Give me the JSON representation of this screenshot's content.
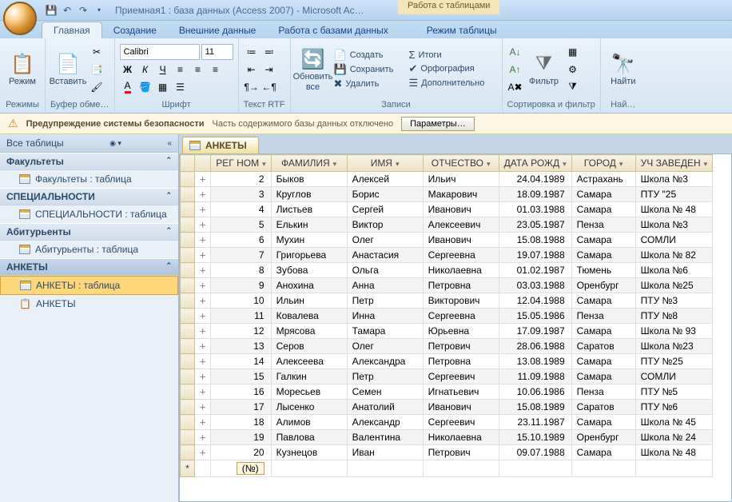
{
  "title": "Приемная1 : база данных (Access 2007) - Microsoft Ac…",
  "context_caption": "Работа с таблицами",
  "tabs": [
    "Главная",
    "Создание",
    "Внешние данные",
    "Работа с базами данных",
    "Режим таблицы"
  ],
  "ribbon": {
    "groups": [
      "Режимы",
      "Буфер обме…",
      "Шрифт",
      "Текст RTF",
      "Записи",
      "Сортировка и фильтр",
      "Най…"
    ],
    "rezhim": "Режим",
    "vstavit": "Вставить",
    "font_name": "Calibri",
    "font_size": "11",
    "obnovit": "Обновить все",
    "records": {
      "sozdat": "Создать",
      "sokhranit": "Сохранить",
      "udalit": "Удалить",
      "itogi": "Итоги",
      "orfo": "Орфография",
      "dopolnit": "Дополнительно"
    },
    "filtr": "Фильтр",
    "najti": "Найти"
  },
  "security": {
    "title": "Предупреждение системы безопасности",
    "text": "Часть содержимого базы данных отключено",
    "button": "Параметры…"
  },
  "nav": {
    "head": "Все таблицы",
    "groups": [
      {
        "name": "Факультеты",
        "items": [
          "Факультеты : таблица"
        ]
      },
      {
        "name": "СПЕЦИАЛЬНОСТИ",
        "items": [
          "СПЕЦИАЛЬНОСТИ : таблица"
        ]
      },
      {
        "name": "Абитурьенты",
        "items": [
          "Абитурьенты : таблица"
        ]
      },
      {
        "name": "АНКЕТЫ",
        "items": [
          "АНКЕТЫ : таблица",
          "АНКЕТЫ"
        ],
        "selected": 0
      }
    ]
  },
  "doc_tab": "АНКЕТЫ",
  "columns": [
    "РЕГ НОМ",
    "ФАМИЛИЯ",
    "ИМЯ",
    "ОТЧЕСТВО",
    "ДАТА РОЖД",
    "ГОРОД",
    "УЧ ЗАВЕДЕН"
  ],
  "rows": [
    {
      "reg": 2,
      "fam": "Быков",
      "imya": "Алексей",
      "otch": "Ильич",
      "dat": "24.04.1989",
      "gor": "Астрахань",
      "uz": "Школа №3"
    },
    {
      "reg": 3,
      "fam": "Круглов",
      "imya": "Борис",
      "otch": "Макарович",
      "dat": "18.09.1987",
      "gor": "Самара",
      "uz": "ПТУ \"25"
    },
    {
      "reg": 4,
      "fam": "Листьев",
      "imya": "Сергей",
      "otch": "Иванович",
      "dat": "01.03.1988",
      "gor": "Самара",
      "uz": "Школа № 48"
    },
    {
      "reg": 5,
      "fam": "Елькин",
      "imya": "Виктор",
      "otch": "Алексеевич",
      "dat": "23.05.1987",
      "gor": "Пенза",
      "uz": "Школа №3"
    },
    {
      "reg": 6,
      "fam": "Мухин",
      "imya": "Олег",
      "otch": "Иванович",
      "dat": "15.08.1988",
      "gor": "Самара",
      "uz": "СОМЛИ"
    },
    {
      "reg": 7,
      "fam": "Григорьева",
      "imya": "Анастасия",
      "otch": "Сергеевна",
      "dat": "19.07.1988",
      "gor": "Самара",
      "uz": "Школа № 82"
    },
    {
      "reg": 8,
      "fam": "Зубова",
      "imya": "Ольга",
      "otch": "Николаевна",
      "dat": "01.02.1987",
      "gor": "Тюмень",
      "uz": "Школа №6"
    },
    {
      "reg": 9,
      "fam": "Анохина",
      "imya": "Анна",
      "otch": "Петровна",
      "dat": "03.03.1988",
      "gor": "Оренбург",
      "uz": "Школа №25"
    },
    {
      "reg": 10,
      "fam": "Ильин",
      "imya": "Петр",
      "otch": "Викторович",
      "dat": "12.04.1988",
      "gor": "Самара",
      "uz": "ПТУ №3"
    },
    {
      "reg": 11,
      "fam": "Ковалева",
      "imya": "Инна",
      "otch": "Сергеевна",
      "dat": "15.05.1986",
      "gor": "Пенза",
      "uz": "ПТУ №8"
    },
    {
      "reg": 12,
      "fam": "Мрясова",
      "imya": "Тамара",
      "otch": "Юрьевна",
      "dat": "17.09.1987",
      "gor": "Самара",
      "uz": "Школа № 93"
    },
    {
      "reg": 13,
      "fam": "Серов",
      "imya": "Олег",
      "otch": "Петрович",
      "dat": "28.06.1988",
      "gor": "Саратов",
      "uz": "Школа №23"
    },
    {
      "reg": 14,
      "fam": "Алексеева",
      "imya": "Александра",
      "otch": "Петровна",
      "dat": "13.08.1989",
      "gor": "Самара",
      "uz": "ПТУ №25"
    },
    {
      "reg": 15,
      "fam": "Галкин",
      "imya": "Петр",
      "otch": "Сергеевич",
      "dat": "11.09.1988",
      "gor": "Самара",
      "uz": "СОМЛИ"
    },
    {
      "reg": 16,
      "fam": "Моресьев",
      "imya": "Семен",
      "otch": "Игнатьевич",
      "dat": "10.06.1986",
      "gor": "Пенза",
      "uz": "ПТУ №5"
    },
    {
      "reg": 17,
      "fam": "Лысенко",
      "imya": "Анатолий",
      "otch": "Иванович",
      "dat": "15.08.1989",
      "gor": "Саратов",
      "uz": "ПТУ №6"
    },
    {
      "reg": 18,
      "fam": "Алимов",
      "imya": "Александр",
      "otch": "Сергеевич",
      "dat": "23.11.1987",
      "gor": "Самара",
      "uz": "Школа № 45"
    },
    {
      "reg": 19,
      "fam": "Павлова",
      "imya": "Валентина",
      "otch": "Николаевна",
      "dat": "15.10.1989",
      "gor": "Оренбург",
      "uz": "Школа № 24"
    },
    {
      "reg": 20,
      "fam": "Кузнецов",
      "imya": "Иван",
      "otch": "Петрович",
      "dat": "09.07.1988",
      "gor": "Самара",
      "uz": "Школа № 48"
    }
  ],
  "new_record": "(№)"
}
